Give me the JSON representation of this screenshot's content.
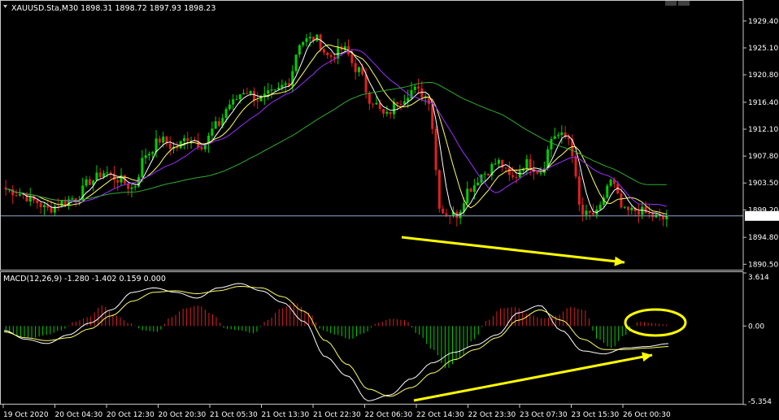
{
  "window": {
    "symbol_info": "XAUUSD.Sta,M30  1898.31 1898.72 1897.93 1898.23",
    "macd_info": "MACD(12,26,9) -1.280 -1.402 0.159 0.000"
  },
  "colors": {
    "background": "#000000",
    "bull": "#00d000",
    "bear": "#e02020",
    "ma_fast": "#ffffff",
    "ma_mid": "#ffff66",
    "ma_slow": "#9b30ff",
    "ma_long": "#2faa2f",
    "price_line": "#8fa8c8",
    "arrow": "#ffff00",
    "grid_frame": "#c8c8c8"
  },
  "chart_data": [
    {
      "type": "line",
      "title": "XAUUSD.Sta,M30",
      "current_price": 1898.23,
      "ylim": [
        1889.5,
        1932.5
      ],
      "y_ticks": [
        "1929.40",
        "1925.10",
        "1920.80",
        "1916.40",
        "1912.10",
        "1907.80",
        "1903.50",
        "1899.20",
        "1894.80",
        "1890.50"
      ],
      "x_ticks": [
        "19 Oct 2020",
        "20 Oct 04:30",
        "20 Oct 12:30",
        "20 Oct 20:30",
        "21 Oct 05:30",
        "21 Oct 13:30",
        "21 Oct 22:30",
        "22 Oct 06:30",
        "22 Oct 14:30",
        "22 Oct 23:30",
        "23 Oct 07:30",
        "23 Oct 15:30",
        "26 Oct 00:30"
      ],
      "series": [
        {
          "values": [
            1902.5,
            1901.8,
            1900.6,
            1899.3,
            1900.4,
            1901.2,
            1903.8,
            1905.2,
            1904.1,
            1902.7,
            1908.2,
            1910.4,
            1909.1,
            1910.8,
            1909.6,
            1912.7,
            1916.2,
            1918.3,
            1916.9,
            1917.8,
            1919.4,
            1926.2,
            1926.6,
            1923.7,
            1924.9,
            1921.7,
            1916.7,
            1914.2,
            1916.8,
            1918.4,
            1917.2,
            1898.9,
            1898.4,
            1902.7,
            1905.1,
            1906.8,
            1904.2,
            1906.7,
            1905.4,
            1911.2,
            1910.7,
            1898.4,
            1898.5,
            1903.7,
            1898.9,
            1899.1,
            1898.2,
            1897.6
          ]
        }
      ],
      "annotations": [
        "divergence arrow on price lows"
      ]
    },
    {
      "type": "bar",
      "title": "MACD(12,26,9)",
      "ylim": [
        -5.354,
        3.614
      ],
      "y_ticks": [
        "3.614",
        "0.00",
        "-5.354"
      ],
      "series": [
        {
          "name": "histogram",
          "values": [
            -0.4,
            -0.7,
            -0.8,
            -0.6,
            -0.3,
            0.3,
            0.6,
            1.4,
            0.7,
            0.2,
            -0.3,
            -0.4,
            0.6,
            1.2,
            1.4,
            0.8,
            -0.2,
            -0.3,
            -0.5,
            0.4,
            1.2,
            1.6,
            0.9,
            -0.3,
            -0.6,
            -0.9,
            -0.5,
            0.2,
            0.5,
            0.4,
            -0.6,
            -1.6,
            -2.9,
            -2.2,
            -0.9,
            0.4,
            1.2,
            1.3,
            0.8,
            0.5,
            0.7,
            1.3,
            1.1,
            -0.9,
            -1.5,
            -0.6,
            0.3,
            0.2,
            0.1
          ]
        },
        {
          "name": "main",
          "values": [
            -0.3,
            -0.9,
            -1.2,
            -0.6,
            0.2,
            1.1,
            2.3,
            2.6,
            2.3,
            1.9,
            2.6,
            2.9,
            2.4,
            1.6,
            0.3,
            -2.1,
            -3.4,
            -5.1,
            -4.7,
            -3.6,
            -2.5,
            -1.8,
            -1.3,
            -0.6,
            0.9,
            1.4,
            -0.3,
            -1.7,
            -1.9,
            -1.5,
            -1.4,
            -1.2
          ]
        },
        {
          "name": "signal",
          "values": [
            -0.4,
            -0.8,
            -1.0,
            -0.8,
            -0.2,
            0.7,
            1.7,
            2.3,
            2.4,
            2.2,
            2.4,
            2.7,
            2.6,
            2.0,
            1.0,
            -1.0,
            -2.6,
            -4.3,
            -4.8,
            -4.2,
            -3.2,
            -2.3,
            -1.6,
            -0.8,
            0.4,
            1.1,
            0.4,
            -0.9,
            -1.6,
            -1.6,
            -1.5,
            -1.4
          ]
        }
      ],
      "annotations": [
        "circle around flattening histogram",
        "divergence arrow on MACD lows"
      ]
    }
  ]
}
